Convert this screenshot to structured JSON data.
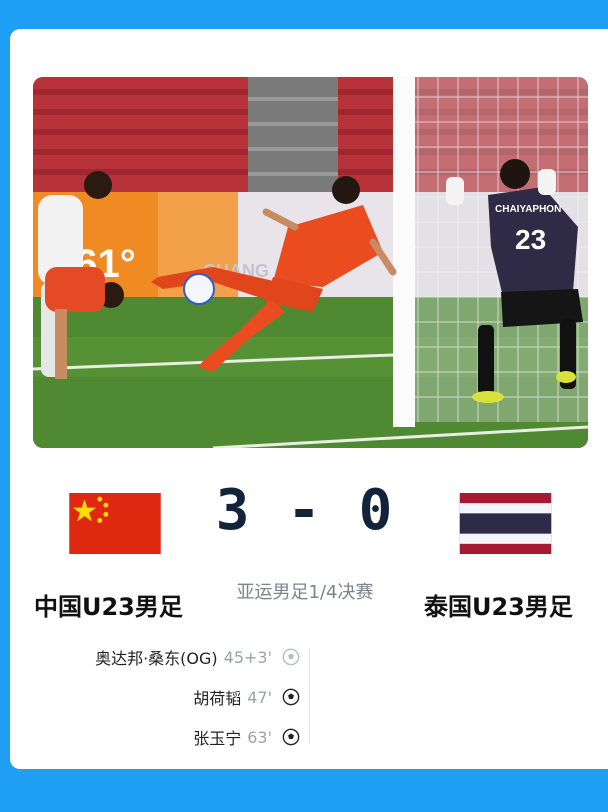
{
  "match": {
    "home_team": "中国U23男足",
    "away_team": "泰国U23男足",
    "score": "3 - 0",
    "stage": "亚运男足1/4决赛"
  },
  "photo_text": {
    "ad_board": "361°",
    "ad_board_2": "CHANG",
    "keeper_jersey": "CHAIYAPHON",
    "keeper_number": "23"
  },
  "events": [
    {
      "player": "奥达邦·桑东(OG)",
      "minute": "45+3'",
      "icon": "own-goal-ball-icon"
    },
    {
      "player": "胡荷韬",
      "minute": "47'",
      "icon": "soccer-ball-icon"
    },
    {
      "player": "张玉宁",
      "minute": "63'",
      "icon": "soccer-ball-icon"
    }
  ],
  "colors": {
    "background": "#1e9ff4",
    "china_red": "#de2910",
    "china_star": "#ffde00",
    "thai_red": "#a51931",
    "thai_blue": "#2d2a4a",
    "score_text": "#13243a"
  }
}
